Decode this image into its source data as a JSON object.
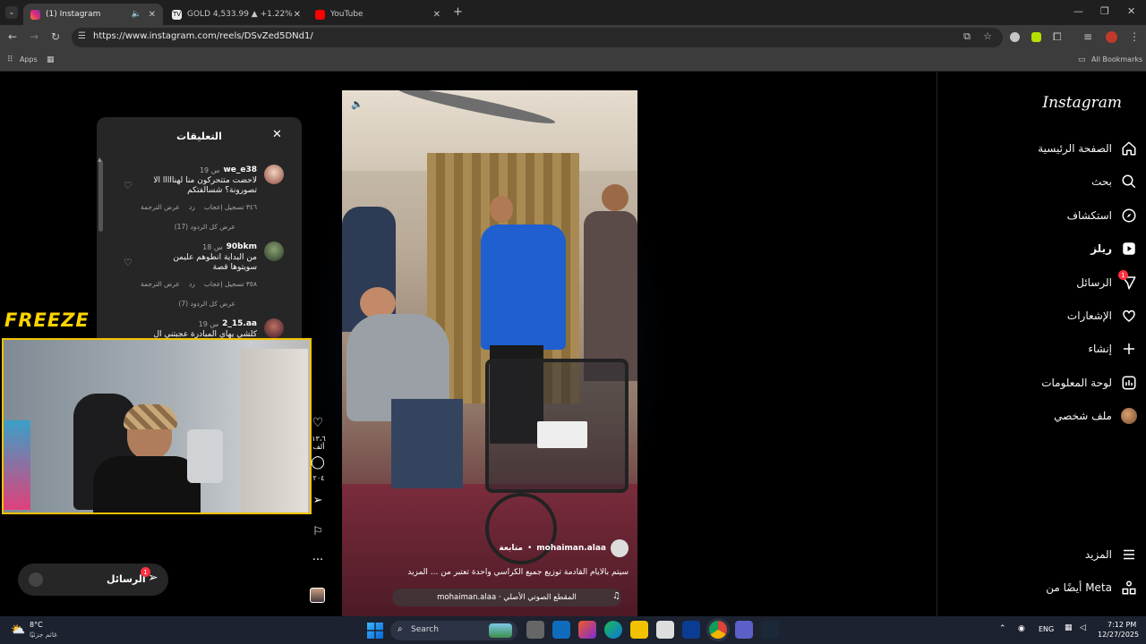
{
  "browser": {
    "tabs": [
      {
        "title": "(1) Instagram",
        "active": true
      },
      {
        "title": "GOLD 4,533.99 ▲ +1.22% Unna",
        "active": false
      },
      {
        "title": "YouTube",
        "active": false
      }
    ],
    "url": "https://www.instagram.com/reels/DSvZed5DNd1/",
    "bookmarks": {
      "apps": "Apps",
      "all": "All Bookmarks"
    }
  },
  "sidebar": {
    "logo": "Instagram",
    "items": [
      {
        "label": "الصفحة الرئيسية",
        "icon": "home-icon"
      },
      {
        "label": "بحث",
        "icon": "search-icon"
      },
      {
        "label": "استكشاف",
        "icon": "explore-icon"
      },
      {
        "label": "ريلز",
        "icon": "reels-icon"
      },
      {
        "label": "الرسائل",
        "icon": "messenger-icon",
        "badge": "1"
      },
      {
        "label": "الإشعارات",
        "icon": "heart-icon"
      },
      {
        "label": "إنشاء",
        "icon": "plus-icon"
      },
      {
        "label": "لوحة المعلومات",
        "icon": "dashboard-icon"
      },
      {
        "label": "ملف شخصي",
        "icon": "avatar-icon"
      }
    ],
    "more": "المزيد",
    "meta": "أيضًا من Meta"
  },
  "comments": {
    "title": "التعليقات",
    "items": [
      {
        "user": "we_e38",
        "time": "19 س",
        "text": "لاحضت متتحركون منا لهنااااا الا تصورونة؟ شسالفتكم",
        "likes": "٣٤٦ تسجيل إعجاب",
        "reply": "رد",
        "translate": "عرض الترجمة",
        "replies": "عرض كل الردود (17)"
      },
      {
        "user": "90bkm",
        "time": "18 س",
        "text": "من البداية انطوهم عليمن سويتوها قصة",
        "likes": "٣٥٨ تسجيل إعجاب",
        "reply": "رد",
        "translate": "عرض الترجمة",
        "replies": "عرض كل الردود (7)"
      },
      {
        "user": "2_15.aa",
        "time": "19 س",
        "text": "كلشي يهاي المبادرة عجبتني ال"
      }
    ]
  },
  "reel": {
    "username": "mohaiman.alaa",
    "follow": "متابعة",
    "caption": "سيتم بالأيام القادمة توزيع جميع الكراسي واحدة تعتبر من ... المزيد",
    "audio": "mohaiman.alaa · المقطع الصوتي الأصلي",
    "likes": "١٣،٦ ألف",
    "comments_count": "٢٠٤"
  },
  "overlay": {
    "freeze": "FREEZE"
  },
  "messages_pill": {
    "label": "الرسائل",
    "badge": "1"
  },
  "taskbar": {
    "weather_temp": "8°C",
    "weather_desc": "غائم جزئيًا",
    "search": "Search",
    "lang": "ENG",
    "time": "7:12 PM",
    "date": "12/27/2025"
  }
}
